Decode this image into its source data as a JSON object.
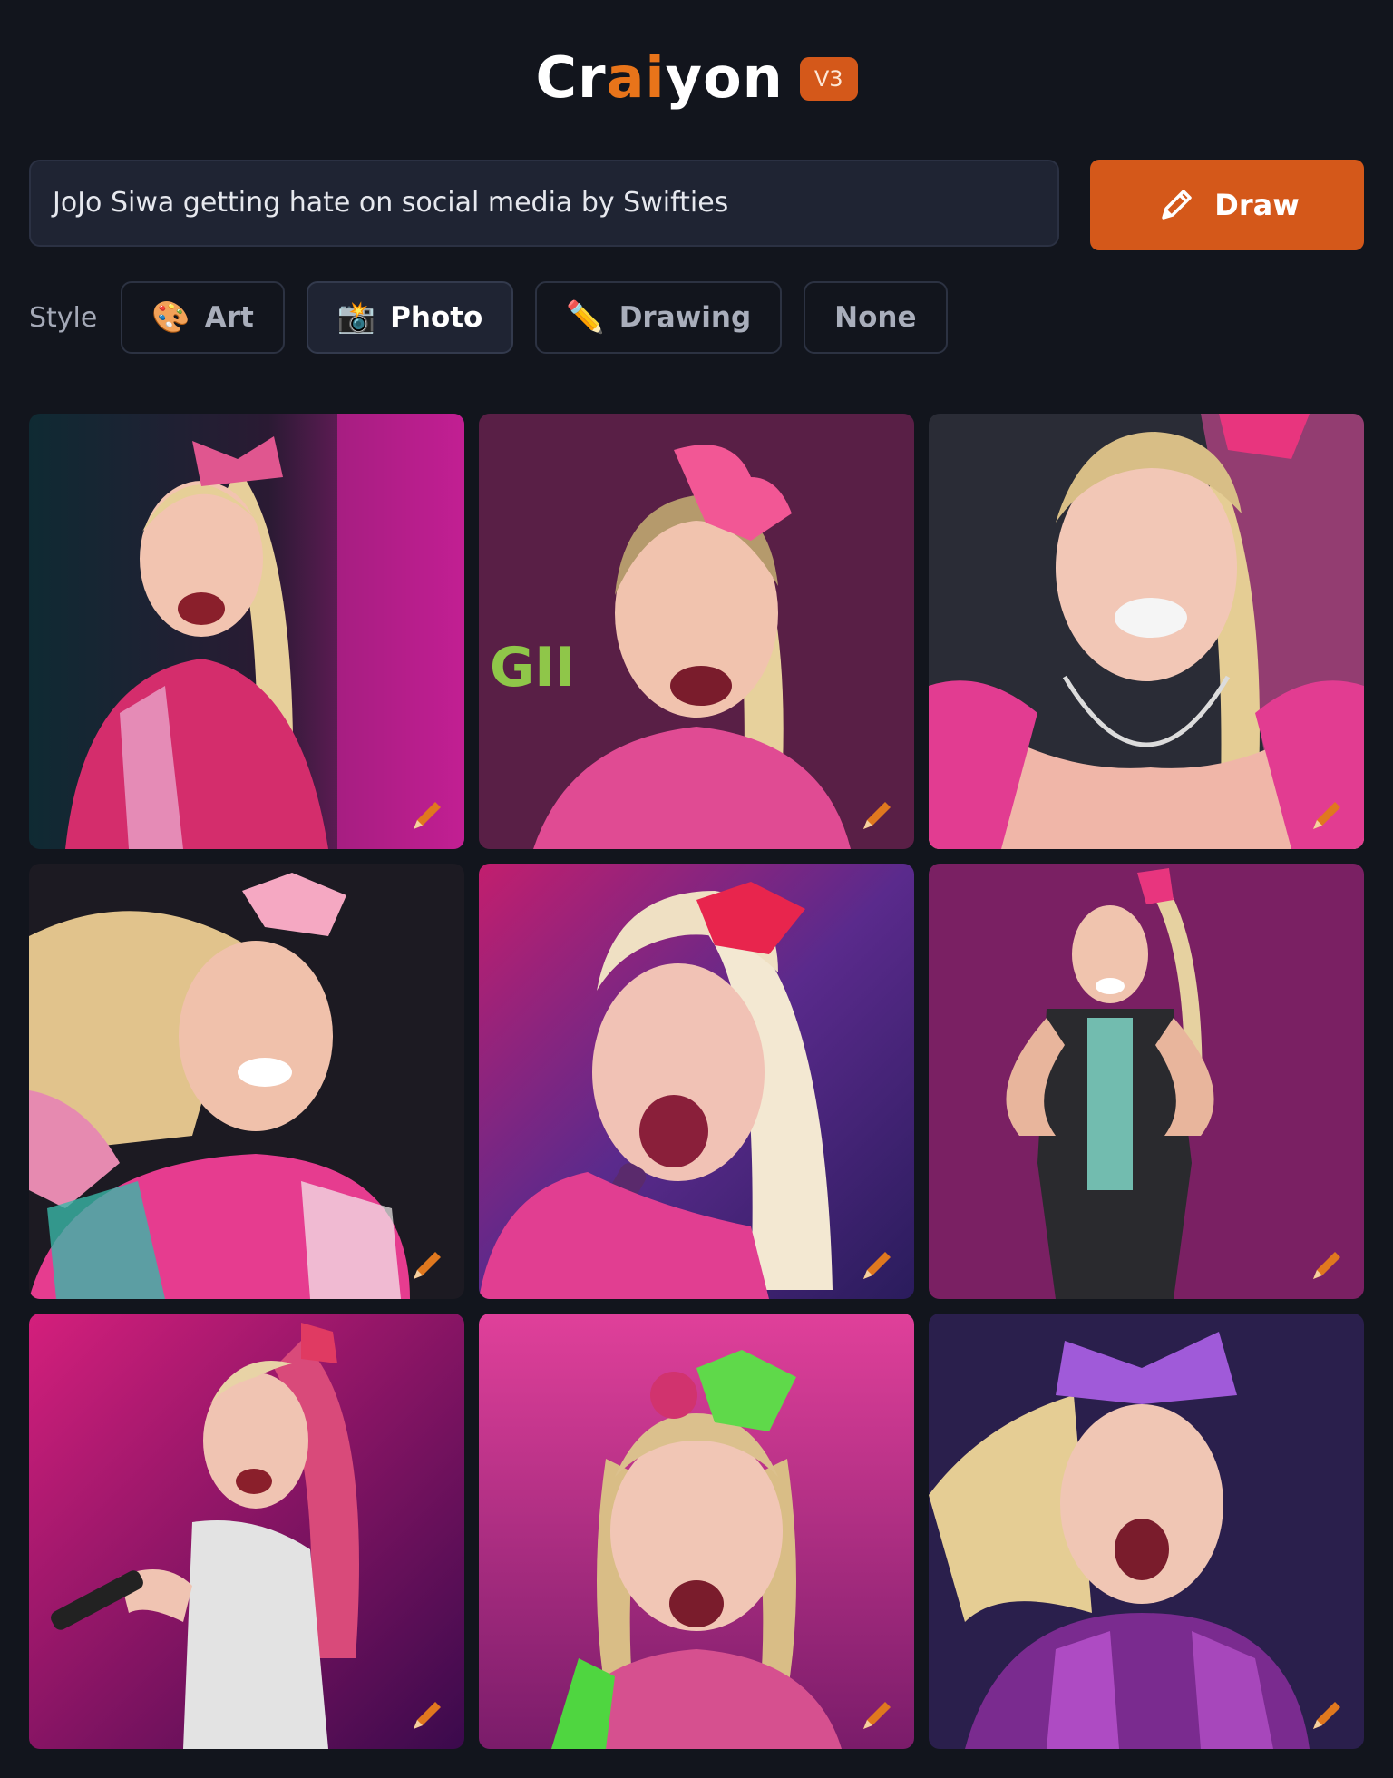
{
  "app": {
    "logo_prefix": "Cr",
    "logo_ai": "ai",
    "logo_suffix": "yon",
    "version_badge": "V3"
  },
  "prompt": {
    "value": "JoJo Siwa getting hate on social media by Swifties"
  },
  "draw_button": {
    "label": "Draw",
    "icon": "pencil-icon"
  },
  "style": {
    "label": "Style",
    "options": [
      {
        "label": "Art",
        "emoji": "🎨",
        "active": false
      },
      {
        "label": "Photo",
        "emoji": "📸",
        "active": true
      },
      {
        "label": "Drawing",
        "emoji": "✏️",
        "active": false
      },
      {
        "label": "None",
        "emoji": "",
        "active": false
      }
    ]
  },
  "gallery": {
    "count": 9,
    "colors": {
      "accent": "#d4581a",
      "background": "#12151d"
    }
  }
}
